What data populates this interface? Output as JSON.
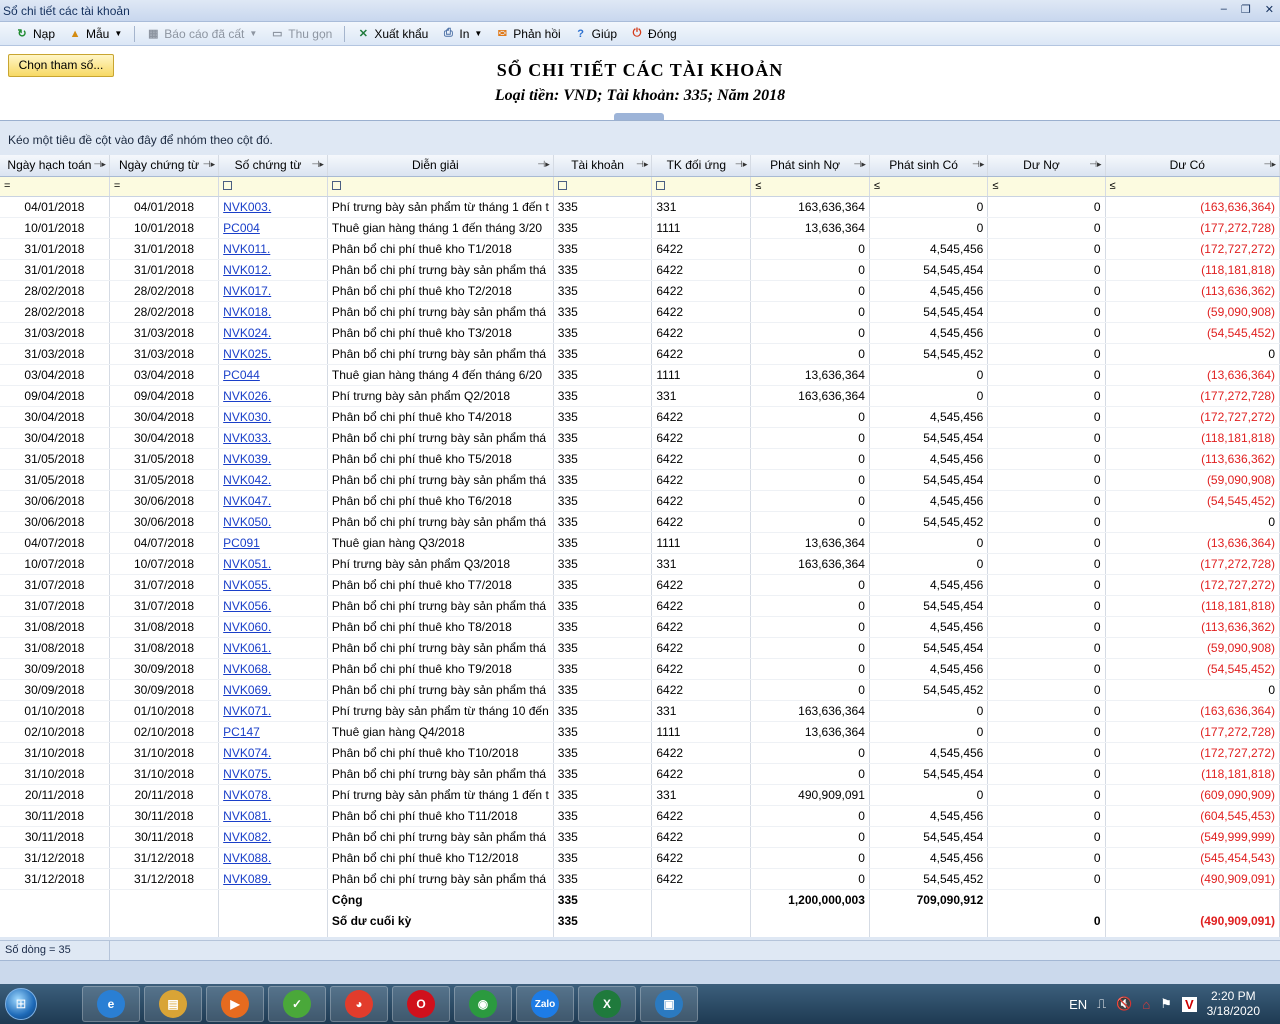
{
  "window": {
    "title": "Sổ chi tiết các tài khoản",
    "minimize": "–",
    "restore": "❐",
    "close": "✕"
  },
  "toolbar": {
    "items": [
      {
        "label": "Nạp",
        "icon": "refresh-icon",
        "enabled": true
      },
      {
        "label": "Mẫu",
        "icon": "template-icon",
        "enabled": true,
        "dropdown": true
      },
      {
        "label": "Báo cáo đã cất",
        "icon": "save-icon",
        "enabled": false,
        "dropdown": true
      },
      {
        "label": "Thu gọn",
        "icon": "collapse-icon",
        "enabled": false
      },
      {
        "label": "Xuất khẩu",
        "icon": "excel-icon",
        "enabled": true
      },
      {
        "label": "In",
        "icon": "print-icon",
        "enabled": true,
        "dropdown": true
      },
      {
        "label": "Phản hồi",
        "icon": "mail-icon",
        "enabled": true
      },
      {
        "label": "Giúp",
        "icon": "help-icon",
        "enabled": true
      },
      {
        "label": "Đóng",
        "icon": "power-icon",
        "enabled": true
      }
    ]
  },
  "params_button": "Chọn tham số...",
  "report": {
    "title": "SỔ CHI TIẾT CÁC TÀI KHOẢN",
    "subtitle": "Loại tiền: VND; Tài khoản: 335; Năm 2018"
  },
  "group_panel": "Kéo một tiêu đề cột vào đây để nhóm theo cột đó.",
  "columns": [
    "Ngày hạch toán",
    "Ngày chứng từ",
    "Số chứng từ",
    "Diễn giải",
    "Tài khoản",
    "TK đối ứng",
    "Phát sinh Nợ",
    "Phát sinh Có",
    "Dư Nợ",
    "Dư Có"
  ],
  "filters": [
    "=",
    "=",
    "☐",
    "☐",
    "☐",
    "☐",
    "≤",
    "≤",
    "≤",
    "≤"
  ],
  "rows": [
    [
      "04/01/2018",
      "04/01/2018",
      "NVK003.",
      "Phí trưng bày sản phẩm từ tháng 1 đến t",
      "335",
      "331",
      "163,636,364",
      "0",
      "0",
      "(163,636,364)"
    ],
    [
      "10/01/2018",
      "10/01/2018",
      "PC004",
      "Thuê gian hàng tháng 1 đến tháng 3/20",
      "335",
      "1111",
      "13,636,364",
      "0",
      "0",
      "(177,272,728)"
    ],
    [
      "31/01/2018",
      "31/01/2018",
      "NVK011.",
      "Phân bổ chi phí thuê kho T1/2018",
      "335",
      "6422",
      "0",
      "4,545,456",
      "0",
      "(172,727,272)"
    ],
    [
      "31/01/2018",
      "31/01/2018",
      "NVK012.",
      "Phân bổ chi phí trưng bày sản phẩm thá",
      "335",
      "6422",
      "0",
      "54,545,454",
      "0",
      "(118,181,818)"
    ],
    [
      "28/02/2018",
      "28/02/2018",
      "NVK017.",
      "Phân bổ chi phí thuê kho T2/2018",
      "335",
      "6422",
      "0",
      "4,545,456",
      "0",
      "(113,636,362)"
    ],
    [
      "28/02/2018",
      "28/02/2018",
      "NVK018.",
      "Phân bổ chi phí trưng bày sản phẩm thá",
      "335",
      "6422",
      "0",
      "54,545,454",
      "0",
      "(59,090,908)"
    ],
    [
      "31/03/2018",
      "31/03/2018",
      "NVK024.",
      "Phân bổ chi phí thuê kho T3/2018",
      "335",
      "6422",
      "0",
      "4,545,456",
      "0",
      "(54,545,452)"
    ],
    [
      "31/03/2018",
      "31/03/2018",
      "NVK025.",
      "Phân bổ chi phí trưng bày sản phẩm thá",
      "335",
      "6422",
      "0",
      "54,545,452",
      "0",
      "0"
    ],
    [
      "03/04/2018",
      "03/04/2018",
      "PC044",
      "Thuê gian hàng tháng 4 đến tháng 6/20",
      "335",
      "1111",
      "13,636,364",
      "0",
      "0",
      "(13,636,364)"
    ],
    [
      "09/04/2018",
      "09/04/2018",
      "NVK026.",
      "Phí trưng bày sản phẩm Q2/2018",
      "335",
      "331",
      "163,636,364",
      "0",
      "0",
      "(177,272,728)"
    ],
    [
      "30/04/2018",
      "30/04/2018",
      "NVK030.",
      "Phân bổ chi phí thuê kho T4/2018",
      "335",
      "6422",
      "0",
      "4,545,456",
      "0",
      "(172,727,272)"
    ],
    [
      "30/04/2018",
      "30/04/2018",
      "NVK033.",
      "Phân bổ chi phí trưng bày sản phẩm thá",
      "335",
      "6422",
      "0",
      "54,545,454",
      "0",
      "(118,181,818)"
    ],
    [
      "31/05/2018",
      "31/05/2018",
      "NVK039.",
      "Phân bổ chi phí thuê kho T5/2018",
      "335",
      "6422",
      "0",
      "4,545,456",
      "0",
      "(113,636,362)"
    ],
    [
      "31/05/2018",
      "31/05/2018",
      "NVK042.",
      "Phân bổ chi phí trưng bày sản phẩm thá",
      "335",
      "6422",
      "0",
      "54,545,454",
      "0",
      "(59,090,908)"
    ],
    [
      "30/06/2018",
      "30/06/2018",
      "NVK047.",
      "Phân bổ chi phí thuê kho T6/2018",
      "335",
      "6422",
      "0",
      "4,545,456",
      "0",
      "(54,545,452)"
    ],
    [
      "30/06/2018",
      "30/06/2018",
      "NVK050.",
      "Phân bổ chi phí trưng bày sản phẩm thá",
      "335",
      "6422",
      "0",
      "54,545,452",
      "0",
      "0"
    ],
    [
      "04/07/2018",
      "04/07/2018",
      "PC091",
      "Thuê gian hàng Q3/2018",
      "335",
      "1111",
      "13,636,364",
      "0",
      "0",
      "(13,636,364)"
    ],
    [
      "10/07/2018",
      "10/07/2018",
      "NVK051.",
      "Phí trưng bày sản phẩm Q3/2018",
      "335",
      "331",
      "163,636,364",
      "0",
      "0",
      "(177,272,728)"
    ],
    [
      "31/07/2018",
      "31/07/2018",
      "NVK055.",
      "Phân bổ chi phí thuê kho T7/2018",
      "335",
      "6422",
      "0",
      "4,545,456",
      "0",
      "(172,727,272)"
    ],
    [
      "31/07/2018",
      "31/07/2018",
      "NVK056.",
      "Phân bổ chi phí trưng bày sản phẩm thá",
      "335",
      "6422",
      "0",
      "54,545,454",
      "0",
      "(118,181,818)"
    ],
    [
      "31/08/2018",
      "31/08/2018",
      "NVK060.",
      "Phân bổ chi phí thuê kho T8/2018",
      "335",
      "6422",
      "0",
      "4,545,456",
      "0",
      "(113,636,362)"
    ],
    [
      "31/08/2018",
      "31/08/2018",
      "NVK061.",
      "Phân bổ chi phí trưng bày sản phẩm thá",
      "335",
      "6422",
      "0",
      "54,545,454",
      "0",
      "(59,090,908)"
    ],
    [
      "30/09/2018",
      "30/09/2018",
      "NVK068.",
      "Phân bổ chi phí thuê kho T9/2018",
      "335",
      "6422",
      "0",
      "4,545,456",
      "0",
      "(54,545,452)"
    ],
    [
      "30/09/2018",
      "30/09/2018",
      "NVK069.",
      "Phân bổ chi phí trưng bày sản phẩm thá",
      "335",
      "6422",
      "0",
      "54,545,452",
      "0",
      "0"
    ],
    [
      "01/10/2018",
      "01/10/2018",
      "NVK071.",
      "Phí trưng bày sản phẩm từ tháng 10 đến",
      "335",
      "331",
      "163,636,364",
      "0",
      "0",
      "(163,636,364)"
    ],
    [
      "02/10/2018",
      "02/10/2018",
      "PC147",
      "Thuê gian hàng Q4/2018",
      "335",
      "1111",
      "13,636,364",
      "0",
      "0",
      "(177,272,728)"
    ],
    [
      "31/10/2018",
      "31/10/2018",
      "NVK074.",
      "Phân bổ chi phí thuê kho T10/2018",
      "335",
      "6422",
      "0",
      "4,545,456",
      "0",
      "(172,727,272)"
    ],
    [
      "31/10/2018",
      "31/10/2018",
      "NVK075.",
      "Phân bổ chi phí trưng bày sản phẩm thá",
      "335",
      "6422",
      "0",
      "54,545,454",
      "0",
      "(118,181,818)"
    ],
    [
      "20/11/2018",
      "20/11/2018",
      "NVK078.",
      "Phí trưng bày sản phẩm từ tháng 1 đến t",
      "335",
      "331",
      "490,909,091",
      "0",
      "0",
      "(609,090,909)"
    ],
    [
      "30/11/2018",
      "30/11/2018",
      "NVK081.",
      "Phân bổ chi phí thuê kho T11/2018",
      "335",
      "6422",
      "0",
      "4,545,456",
      "0",
      "(604,545,453)"
    ],
    [
      "30/11/2018",
      "30/11/2018",
      "NVK082.",
      "Phân bổ chi phí trưng bày sản phẩm thá",
      "335",
      "6422",
      "0",
      "54,545,454",
      "0",
      "(549,999,999)"
    ],
    [
      "31/12/2018",
      "31/12/2018",
      "NVK088.",
      "Phân bổ chi phí thuê kho T12/2018",
      "335",
      "6422",
      "0",
      "4,545,456",
      "0",
      "(545,454,543)"
    ],
    [
      "31/12/2018",
      "31/12/2018",
      "NVK089.",
      "Phân bổ chi phí trưng bày sản phẩm thá",
      "335",
      "6422",
      "0",
      "54,545,452",
      "0",
      "(490,909,091)"
    ]
  ],
  "totals": {
    "label": "Cộng",
    "account": "335",
    "debit": "1,200,000,003",
    "credit": "709,090,912"
  },
  "closing": {
    "label": "Số dư cuối kỳ",
    "account": "335",
    "debit_balance": "0",
    "credit_balance": "(490,909,091)"
  },
  "status": {
    "row_count": "Số dòng = 35"
  },
  "taskbar": {
    "apps": [
      {
        "icon": "ie-icon",
        "glyph": "e",
        "color": "#2a7fd4"
      },
      {
        "icon": "explorer-icon",
        "glyph": "▤",
        "color": "#d9a436"
      },
      {
        "icon": "media-player-icon",
        "glyph": "▶",
        "color": "#e66b1f"
      },
      {
        "icon": "accounting-app-icon",
        "glyph": "✓",
        "color": "#4aa83a"
      },
      {
        "icon": "paint-icon",
        "glyph": "◕",
        "color": "#e23c2c"
      },
      {
        "icon": "opera-icon",
        "glyph": "O",
        "color": "#d0101c"
      },
      {
        "icon": "chrome-icon",
        "glyph": "◉",
        "color": "#2b9a3f"
      },
      {
        "icon": "zalo-icon",
        "glyph": "Zalo",
        "color": "#1d7ce6"
      },
      {
        "icon": "excel-icon",
        "glyph": "X",
        "color": "#1f7a3c"
      },
      {
        "icon": "remote-desktop-icon",
        "glyph": "▣",
        "color": "#2b7ac0"
      }
    ],
    "lang": "EN",
    "time": "2:20 PM",
    "date": "3/18/2020"
  }
}
